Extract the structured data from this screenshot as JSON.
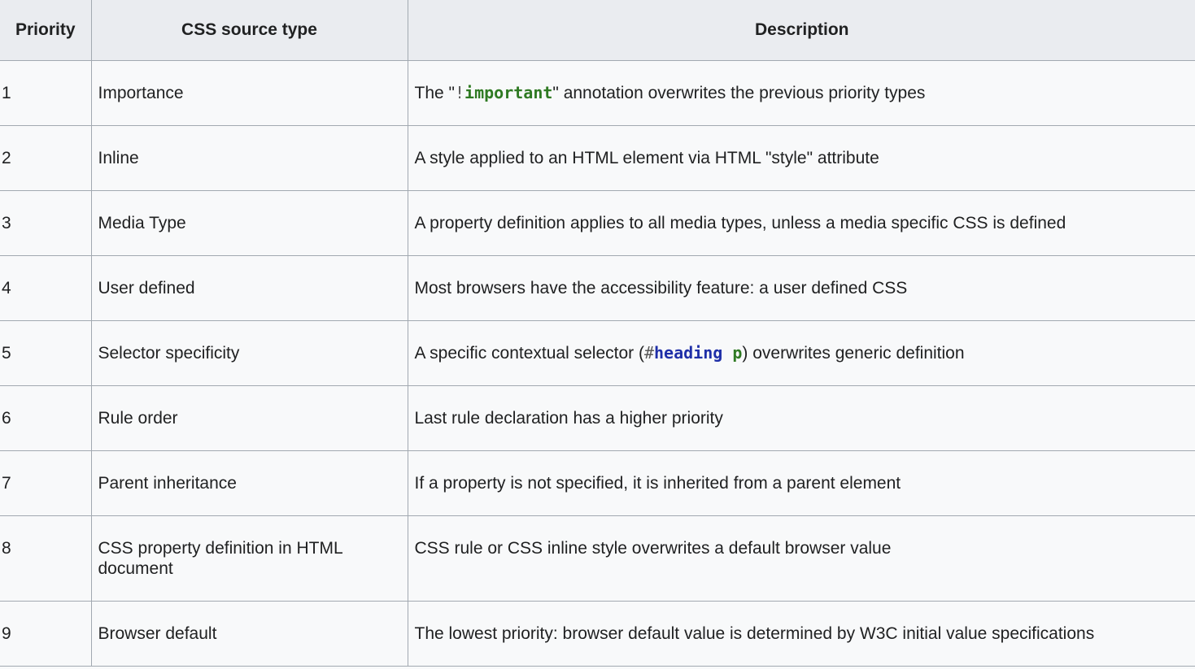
{
  "table": {
    "headers": {
      "priority": "Priority",
      "source_type": "CSS source type",
      "description": "Description"
    },
    "rows": [
      {
        "priority": "1",
        "source_type": "Importance",
        "description": {
          "before": "The \"",
          "code_bang": "!",
          "code_keyword": "important",
          "after": "\" annotation overwrites the previous priority types"
        }
      },
      {
        "priority": "2",
        "source_type": "Inline",
        "description": "A style applied to an HTML element via HTML \"style\" attribute"
      },
      {
        "priority": "3",
        "source_type": "Media Type",
        "description": "A property definition applies to all media types, unless a media specific CSS is defined"
      },
      {
        "priority": "4",
        "source_type": "User defined",
        "description": "Most browsers have the accessibility feature: a user defined CSS"
      },
      {
        "priority": "5",
        "source_type": "Selector specificity",
        "description": {
          "before": "A specific contextual selector (",
          "code_hash": "#",
          "code_id": "heading",
          "code_space": " ",
          "code_elem": "p",
          "after": ") overwrites generic definition"
        }
      },
      {
        "priority": "6",
        "source_type": "Rule order",
        "description": "Last rule declaration has a higher priority"
      },
      {
        "priority": "7",
        "source_type": "Parent inheritance",
        "description": "If a property is not specified, it is inherited from a parent element"
      },
      {
        "priority": "8",
        "source_type": "CSS property definition in HTML document",
        "description": "CSS rule or CSS inline style overwrites a default browser value"
      },
      {
        "priority": "9",
        "source_type": "Browser default",
        "description": "The lowest priority: browser default value is determined by W3C initial value specifications"
      }
    ]
  },
  "colors": {
    "code_green": "#2f7a23",
    "code_blue": "#1f2fa8",
    "header_bg": "#eaecf0",
    "cell_bg": "#f8f9fa",
    "border": "#a2a9b1"
  }
}
